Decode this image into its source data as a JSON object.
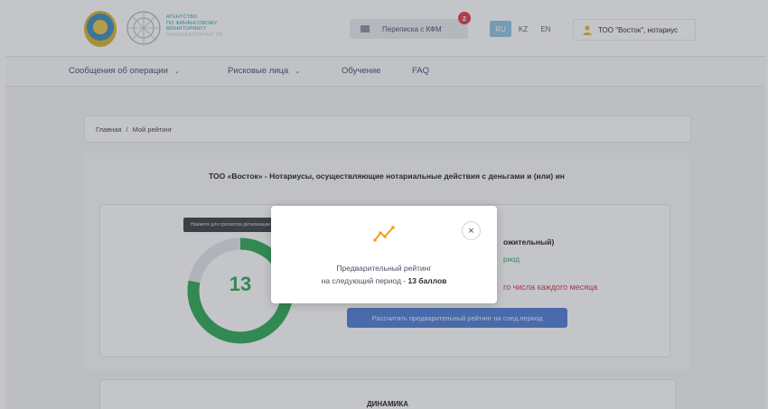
{
  "header": {
    "agency_lines": [
      "АГЕНТСТВО",
      "ПО ФИНАНСОВОМУ",
      "МОНИТОРИНГУ"
    ],
    "agency_sub": "Финмониторинг РК",
    "correspondence_label": "Переписка с КФМ",
    "correspondence_badge": "2",
    "languages": [
      "RU",
      "KZ",
      "EN"
    ],
    "active_language": "RU",
    "user_label": "ТОО \"Восток\", нотариус"
  },
  "nav": {
    "items": [
      {
        "label": "Сообщения об операции",
        "dropdown": true
      },
      {
        "label": "Рисковые лица",
        "dropdown": true
      },
      {
        "label": "Обучение",
        "dropdown": false
      },
      {
        "label": "FAQ",
        "dropdown": false
      }
    ]
  },
  "breadcrumb": {
    "home": "Главная",
    "separator": "/",
    "current": "Мой рейтинг"
  },
  "rating": {
    "title": "ТОО «Восток» - Нотариусы, осуществляющие нотариальные действия с деньгами и (или) ин",
    "score": "13",
    "score_fraction": 0.78,
    "tooltip": "Нажмите для просмотра детализации",
    "status_text": "ожительный)",
    "period_text": "риод",
    "deadline_text": "го числа каждого месяца",
    "calc_button": "Рассчитать предварительный рейтинг на след.период",
    "colors": {
      "good": "#2eaa57",
      "track": "#e3e5ea",
      "warn": "#d93a4a",
      "primary": "#4f7fd6"
    }
  },
  "dynamics": {
    "title": "ДИНАМИКА"
  },
  "modal": {
    "icon": "trend-chart-icon",
    "line1": "Предварительный рейтинг",
    "line2_prefix": "на следующий период - ",
    "line2_value": "13 баллов",
    "close_icon": "close-icon"
  }
}
